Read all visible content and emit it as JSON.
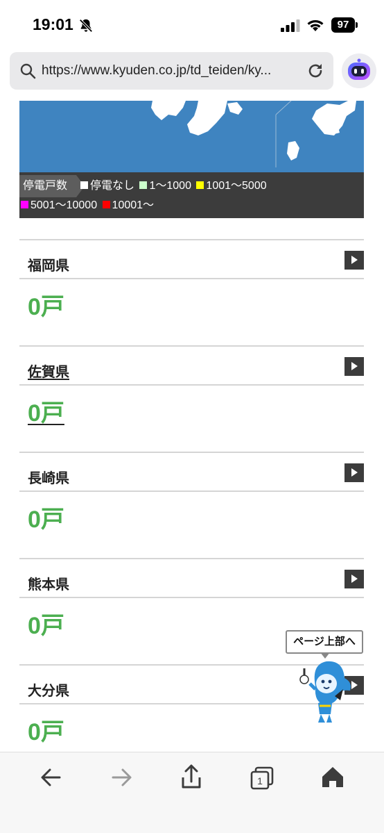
{
  "status": {
    "time": "19:01",
    "battery": "97"
  },
  "browser": {
    "url": "https://www.kyuden.co.jp/td_teiden/ky..."
  },
  "legend": {
    "title": "停電戸数",
    "items": [
      {
        "label": "停電なし",
        "color": "#ffffff"
      },
      {
        "label": "1〜1000",
        "color": "#ccffcc"
      },
      {
        "label": "1001〜5000",
        "color": "#ffff00"
      },
      {
        "label": "5001〜10000",
        "color": "#ff00ff"
      },
      {
        "label": "10001〜",
        "color": "#ff0000"
      }
    ]
  },
  "prefectures": [
    {
      "name": "福岡県",
      "count": "0戸"
    },
    {
      "name": "佐賀県",
      "count": "0戸"
    },
    {
      "name": "長崎県",
      "count": "0戸"
    },
    {
      "name": "熊本県",
      "count": "0戸"
    },
    {
      "name": "大分県",
      "count": "0戸"
    }
  ],
  "page_top": {
    "label": "ページ上部へ"
  },
  "colors": {
    "map_sea": "#3f84c0",
    "count_green": "#4caf50",
    "legend_bg": "#3c3c3c"
  },
  "toolbar": {
    "tab_count": "1"
  }
}
